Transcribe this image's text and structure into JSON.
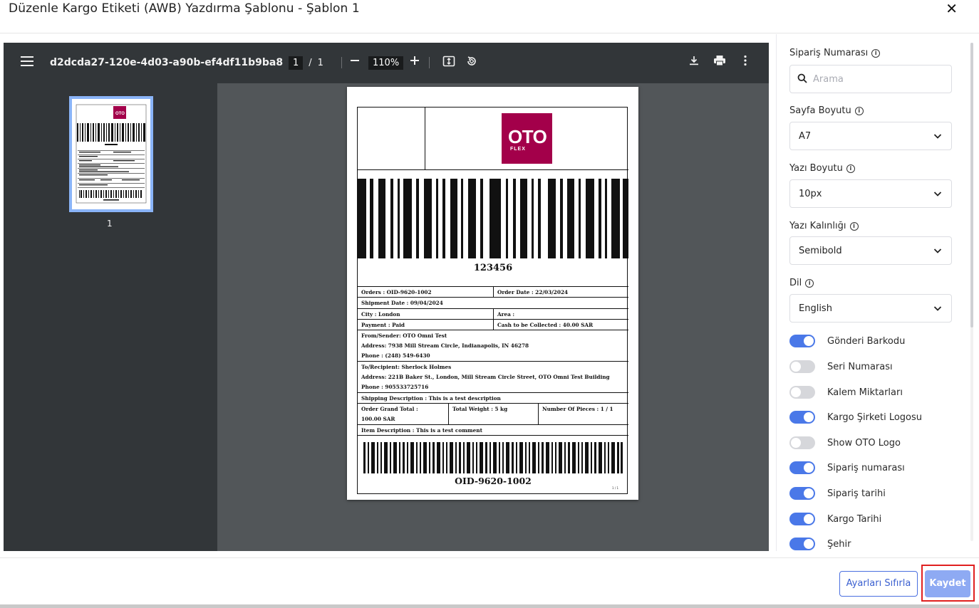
{
  "modal": {
    "title": "Düzenle Kargo Etiketi (AWB) Yazdırma Şablonu - Şablon 1",
    "close": "✕"
  },
  "viewer": {
    "filename": "d2dcda27-120e-4d03-a90b-ef4df11b9ba8",
    "page_current": "1",
    "page_sep": "/",
    "page_total": "1",
    "zoom": "110%",
    "thumb_page": "1"
  },
  "label": {
    "logo_big": "OTO",
    "logo_small": "FLEX",
    "barcode_number": "123456",
    "orders": "Orders :   OID-9620-1002",
    "order_date": "Order Date :   22/03/2024",
    "shipment_date": "Shipment Date :   09/04/2024",
    "city": "City :   London",
    "area": "Area :",
    "payment": "Payment :   Paid",
    "cash": "Cash to be Collected :   40.00 SAR",
    "from": "From/Sender:  OTO Omni Test",
    "from_address": "Address:  7938 Mill Stream Circle, Indianapolis, IN 46278",
    "from_phone": "Phone :  (248) 549-6430",
    "to": "To/Recipient:  Sherlock Holmes",
    "to_address": "Address:  221B Baker St., London, Mill Stream Circle Street, OTO Omni Test Building",
    "to_phone": "Phone :  905533725716",
    "shipping_desc": "Shipping Description :    This is a test description",
    "grand_total_label": "Order Grand Total :",
    "grand_total_value": "100.00 SAR",
    "total_weight": "Total Weight :    5 kg",
    "pieces": "Number Of Pieces :    1 / 1",
    "item_desc": "Item Description :    This is a test comment",
    "bottom_barcode": "OID-9620-1002",
    "page_footer": "1 / 1"
  },
  "panel": {
    "order_number_label": "Sipariş Numarası",
    "search_placeholder": "Arama",
    "page_size_label": "Sayfa Boyutu",
    "page_size_value": "A7",
    "font_size_label": "Yazı Boyutu",
    "font_size_value": "10px",
    "font_weight_label": "Yazı Kalınlığı",
    "font_weight_value": "Semibold",
    "language_label": "Dil",
    "language_value": "English",
    "toggles": [
      {
        "label": "Gönderi Barkodu",
        "on": true
      },
      {
        "label": "Seri Numarası",
        "on": false
      },
      {
        "label": "Kalem Miktarları",
        "on": false
      },
      {
        "label": "Kargo Şirketi Logosu",
        "on": true
      },
      {
        "label": "Show OTO Logo",
        "on": false
      },
      {
        "label": "Sipariş numarası",
        "on": true
      },
      {
        "label": "Sipariş tarihi",
        "on": true
      },
      {
        "label": "Kargo Tarihi",
        "on": true
      },
      {
        "label": "Şehir",
        "on": true
      }
    ]
  },
  "footer": {
    "reset_label": "Ayarları Sıfırla",
    "save_label": "Kaydet"
  },
  "colors": {
    "accent": "#4a78e8",
    "save_bg": "#8eaaf3",
    "brand": "#a3004a",
    "highlight": "#e02020"
  }
}
